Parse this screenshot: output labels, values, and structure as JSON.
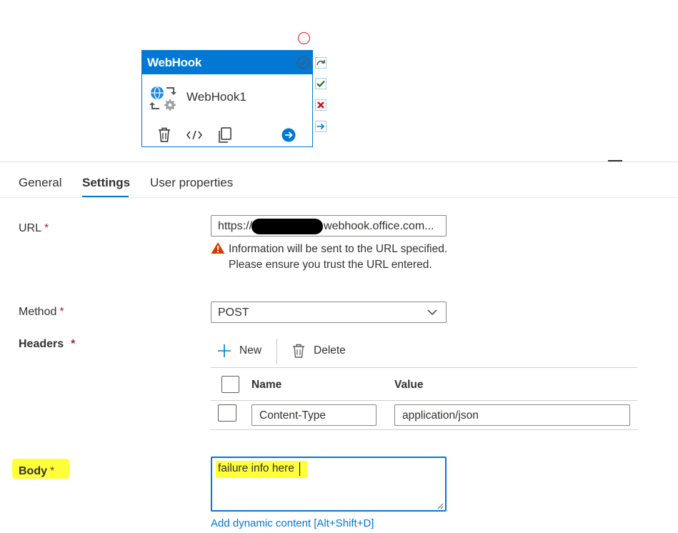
{
  "activity": {
    "header": "WebHook",
    "name": "WebHook1",
    "toolbar_icons": [
      "delete-icon",
      "code-icon",
      "copy-icon",
      "arrow-right-icon"
    ],
    "side_icons": [
      "skipped-icon",
      "success-icon",
      "failure-icon",
      "completion-icon"
    ]
  },
  "tabs": [
    {
      "label": "General",
      "selected": false
    },
    {
      "label": "Settings",
      "selected": true
    },
    {
      "label": "User properties",
      "selected": false
    }
  ],
  "form": {
    "url": {
      "label": "URL",
      "required_mark": "*",
      "value_prefix": "https://",
      "value_suffix": "webhook.office.com...",
      "warning": "Information will be sent to the URL specified. Please ensure you trust the URL entered."
    },
    "method": {
      "label": "Method",
      "required_mark": "*",
      "value": "POST"
    },
    "headers": {
      "label": "Headers",
      "required_mark": "*",
      "new_label": "New",
      "delete_label": "Delete",
      "col_name": "Name",
      "col_value": "Value",
      "rows": [
        {
          "name": "Content-Type",
          "value": "application/json"
        }
      ]
    },
    "body": {
      "label": "Body",
      "required_mark": "*",
      "value": "failure info here",
      "dynamic_link": "Add dynamic content [Alt+Shift+D]"
    }
  },
  "colors": {
    "accent": "#0078d4",
    "required": "#a4262c",
    "highlight": "#ffff3a",
    "warning": "#d83b01"
  }
}
